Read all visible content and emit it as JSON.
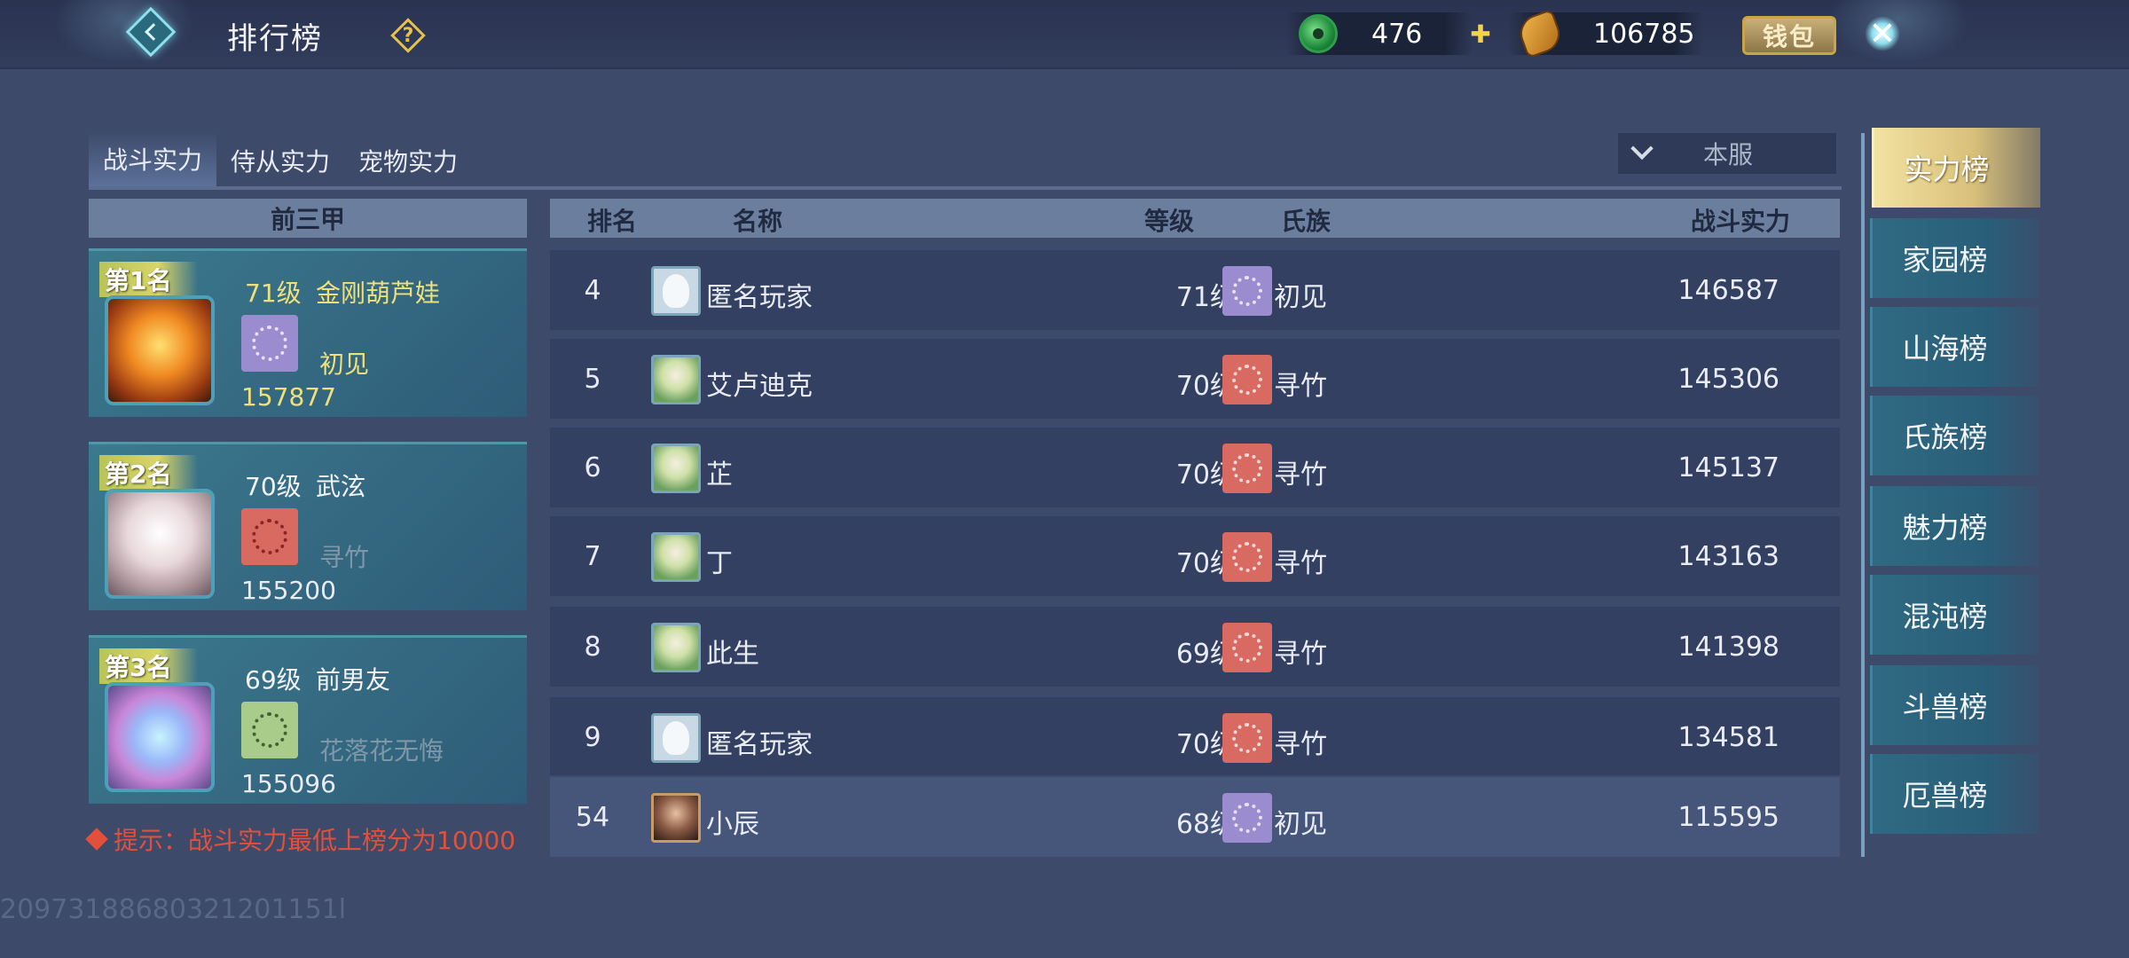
{
  "header": {
    "title": "排行榜",
    "help_icon": "question-icon",
    "jade_amount": "476",
    "gold_amount": "106785",
    "wallet_label": "钱包"
  },
  "tabs": [
    {
      "label": "战斗实力",
      "active": true
    },
    {
      "label": "侍从实力",
      "active": false
    },
    {
      "label": "宠物实力",
      "active": false
    }
  ],
  "server_filter": {
    "selected": "本服"
  },
  "top3": {
    "header": "前三甲",
    "entries": [
      {
        "badge": "第1名",
        "level": "71级",
        "name": "金刚葫芦娃",
        "clan": "初见",
        "power": "157877"
      },
      {
        "badge": "第2名",
        "level": "70级",
        "name": "武泫",
        "clan": "寻竹",
        "power": "155200"
      },
      {
        "badge": "第3名",
        "level": "69级",
        "name": "前男友",
        "clan": "花落花无悔",
        "power": "155096"
      }
    ]
  },
  "tip": "提示：战斗实力最低上榜分为10000",
  "table": {
    "headers": {
      "rank": "排名",
      "name": "名称",
      "level": "等级",
      "clan": "氏族",
      "power": "战斗实力"
    },
    "rows": [
      {
        "rank": "4",
        "name": "匿名玩家",
        "level": "71级",
        "clan": "初见",
        "power": "146587"
      },
      {
        "rank": "5",
        "name": "艾卢迪克",
        "level": "70级",
        "clan": "寻竹",
        "power": "145306"
      },
      {
        "rank": "6",
        "name": "芷",
        "level": "70级",
        "clan": "寻竹",
        "power": "145137"
      },
      {
        "rank": "7",
        "name": "丁",
        "level": "70级",
        "clan": "寻竹",
        "power": "143163"
      },
      {
        "rank": "8",
        "name": "此生",
        "level": "69级",
        "clan": "寻竹",
        "power": "141398"
      },
      {
        "rank": "9",
        "name": "匿名玩家",
        "level": "70级",
        "clan": "寻竹",
        "power": "134581"
      }
    ],
    "self_row": {
      "rank": "54",
      "name": "小辰",
      "level": "68级",
      "clan": "初见",
      "power": "115595"
    }
  },
  "sidebar": {
    "items": [
      {
        "label": "实力榜",
        "active": true
      },
      {
        "label": "家园榜",
        "active": false
      },
      {
        "label": "山海榜",
        "active": false
      },
      {
        "label": "氏族榜",
        "active": false
      },
      {
        "label": "魅力榜",
        "active": false
      },
      {
        "label": "混沌榜",
        "active": false
      },
      {
        "label": "斗兽榜",
        "active": false
      },
      {
        "label": "厄兽榜",
        "active": false
      }
    ]
  },
  "watermark": "20973188680321201151l"
}
